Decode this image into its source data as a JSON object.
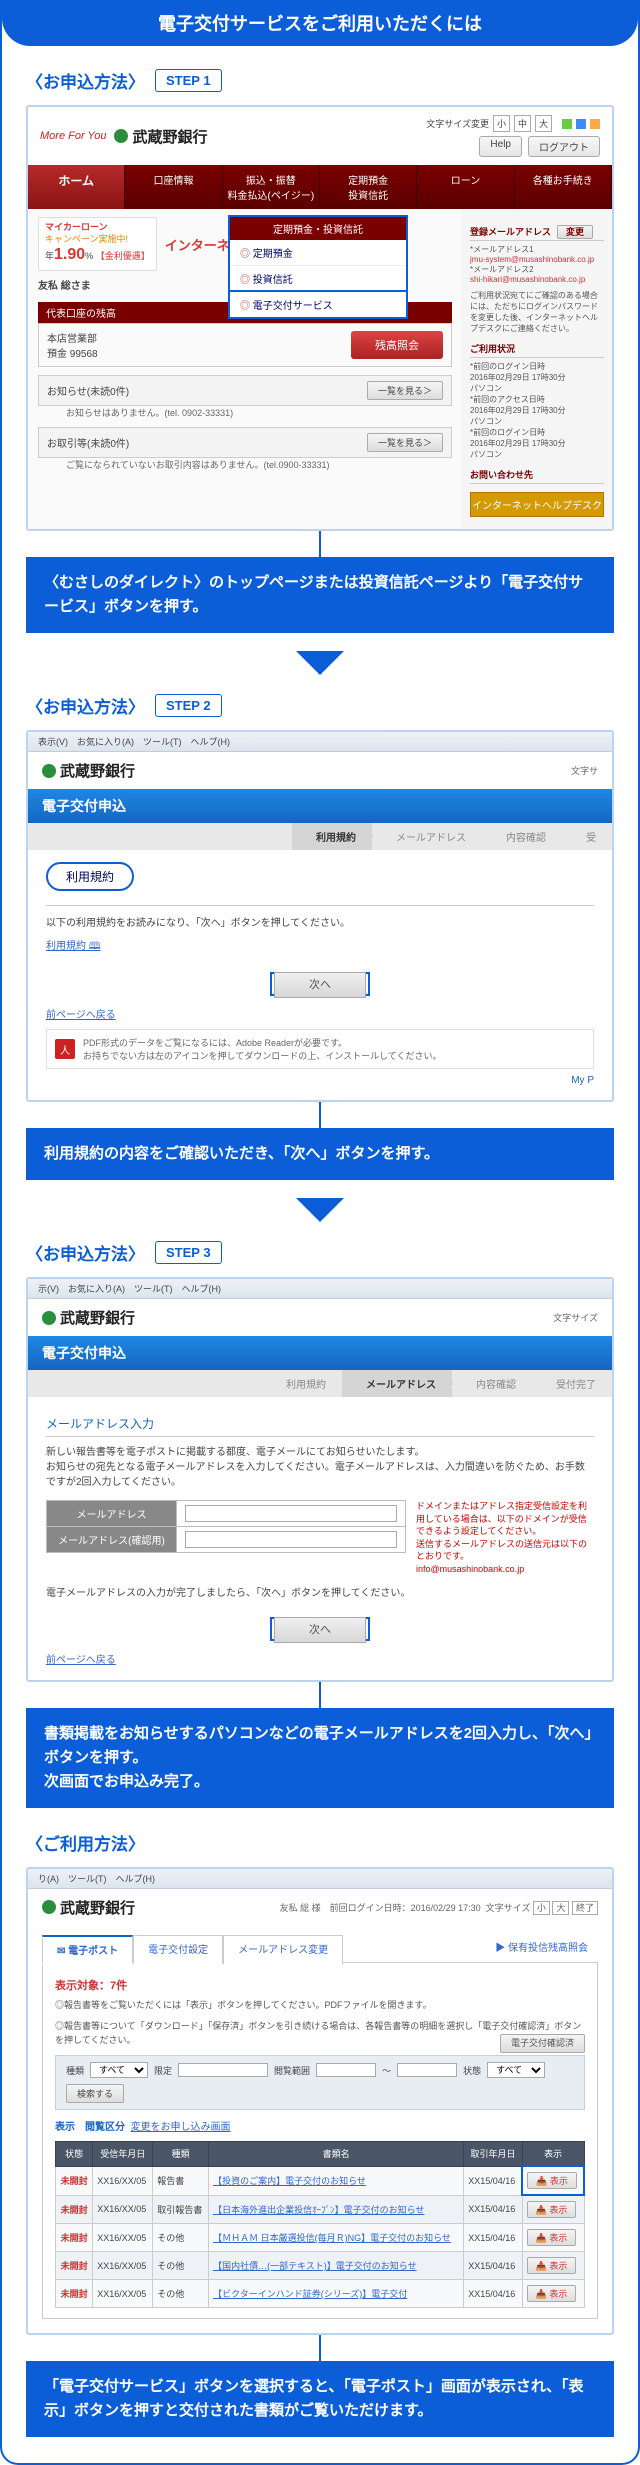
{
  "title": "電子交付サービスをご利用いただくには",
  "section_label": "〈お申込方法〉",
  "usage_label": "〈ご利用方法〉",
  "steps": {
    "s1": "STEP 1",
    "s2": "STEP 2",
    "s3": "STEP 3"
  },
  "captions": {
    "c1": "〈むさしのダイレクト〉のトップページまたは投資信託ページより「電子交付サービス」ボタンを押す。",
    "c2": "利用規約の内容をご確認いただき、「次へ」ボタンを押す。",
    "c3": "書類掲載をお知らせするパソコンなどの電子メールアドレスを2回入力し、「次へ」ボタンを押す。\n次画面でお申込み完了。",
    "c4": "「電子交付サービス」ボタンを選択すると、「電子ポスト」画面が表示され、「表示」ボタンを押すと交付された書類がご覧いただけます。"
  },
  "s1": {
    "mfy": "More For You",
    "bank": "武蔵野銀行",
    "font_label": "文字サイズ変更",
    "fs": [
      "小",
      "中",
      "大"
    ],
    "help": "Help",
    "logout": "ログアウト",
    "nav": [
      "ホーム",
      "口座情報",
      "振込・振替\n料金払込(ペイジー)",
      "定期預金\n投資信託",
      "ローン",
      "各種お手続き"
    ],
    "popup_hd": "定期預金・投資信託",
    "popup_items": [
      "定期預金",
      "投資信託",
      "電子交付サービス"
    ],
    "mycar_t": "マイカーローン",
    "mycar_s": "キャンペーン実施中!",
    "mycar_pre": "年",
    "mycar_rate": "1.90",
    "mycar_pct": "%",
    "mycar_note": "【金利優遇】",
    "internet": "インターネ",
    "greet": "友私 総さま",
    "sec_balance": "代表口座の残高",
    "acct_branch": "本店営業部",
    "acct_type": "預金 99568",
    "inquiry_btn": "残高照会",
    "notice_hd": "お知らせ(未読0件)",
    "notice_txt": "お知らせはありません。(tel. 0902-33331)",
    "deal_hd": "お取引等(未読0件)",
    "deal_txt": "ご覧になられていないお取引内容はありません。(tel.0900-33331)",
    "list_btn": "一覧を見る＞",
    "right": {
      "r1_hd": "登録メールアドレス",
      "r1_chg": "変更",
      "r1_sub": "*メールアドレス1",
      "r1_v1": "jmu-system@musashinobank.co.jp",
      "r1_sub2": "*メールアドレス2",
      "r1_v2": "shi-hikari@musashinobank.co.jp",
      "r2_hd": "ご利用状況宛てにご確認のある場合には、ただちにログインパスワードを変更した後、インターネットヘルプデスクにご連絡ください。",
      "r3_hd": "ご利用状況",
      "r3_a": "*前回のログイン日時",
      "r3_av": "2016年02月29日 17時30分\nパソコン",
      "r3_b": "*前回のアクセス日時",
      "r3_bv": "2016年02月29日 17時30分\nパソコン",
      "r3_c": "*前回のログイン日時",
      "r3_cv": "2016年02月29日 17時30分\nパソコン",
      "r4_hd": "お問い合わせ先",
      "helpdesk": "インターネットヘルプデスク"
    }
  },
  "s2": {
    "ie": "表示(V)　お気に入り(A)　ツール(T)　ヘルプ(H)",
    "bank": "武蔵野銀行",
    "right": "文字サ",
    "band": "電子交付申込",
    "crumbs": [
      "利用規約",
      "メールアドレス",
      "内容確認",
      "受"
    ],
    "oval": "利用規約",
    "txt": "以下の利用規約をお読みになり、「次へ」ボタンを押してください。",
    "link": "利用規約 🕮",
    "next": "次へ",
    "back": "前ページへ戻る",
    "pdf1": "PDF形式のデータをご覧になるには、Adobe Readerが必要です。",
    "pdf2": "お持ちでない方は左のアイコンを押してダウンロードの上、インストールしてください。",
    "myp": "My P"
  },
  "s3": {
    "ie": "示(V)　お気に入り(A)　ツール(T)　ヘルプ(H)",
    "bank": "武蔵野銀行",
    "right": "文字サイズ",
    "band": "電子交付申込",
    "crumbs": [
      "利用規約",
      "メールアドレス",
      "内容確認",
      "受付完了"
    ],
    "sec_hd": "メールアドレス入力",
    "para1": "新しい報告書等を電子ポストに掲載する都度、電子メールにてお知らせいたします。",
    "para2": "お知らせの宛先となる電子メールアドレスを入力してください。電子メールアドレスは、入力間違いを防ぐため、お手数ですが2回入力してください。",
    "fld1": "メールアドレス",
    "fld2": "メールアドレス(確認用)",
    "rnote1": "ドメインまたはアドレス指定受信設定を利用している場合は、以下のドメインが受信できるよう設定してください。",
    "rnote2": "送信するメールアドレスの送信元は以下のとおりです。",
    "rnote3": "info@musashinobank.co.jp",
    "done": "電子メールアドレスの入力が完了しましたら、「次へ」ボタンを押してください。",
    "next": "次へ",
    "back": "前ページへ戻る"
  },
  "s4": {
    "ie": "り(A)　ツール(T)　ヘルプ(H)",
    "bank": "武蔵野銀行",
    "user_info": "友私 総 様　前回ログイン日時：2016/02/29 17:30",
    "font_label": "文字サイズ",
    "fs": [
      "小",
      "大",
      "終了"
    ],
    "tabs": [
      "電子ポスト",
      "電子交付設定",
      "メールアドレス変更"
    ],
    "tab_icon": "✉",
    "right_link": "▶ 保有投信残高照会",
    "count": "表示対象：7件",
    "note1": "◎報告書等をご覧いただくには「表示」ボタンを押してください。PDFファイルを開きます。",
    "note2": "◎報告書等について「ダウンロード」「保存済」ボタンを引き続ける場合は、各報告書等の明細を選択し「電子交付確認済」ボタンを押してください。",
    "confirm_btn": "電子交付確認済",
    "sub_hd": "表示　閲覧区分",
    "sub_link": "変更をお申し込み画面",
    "sb_lbl_kind": "種類",
    "sb_all": "すべて",
    "sb_strict": "限定",
    "sb_lbl_period": "閲覧範囲",
    "sb_lbl_stat": "状態",
    "sb_search": "検索する",
    "th": [
      "状態",
      "受信年月日",
      "種類",
      "書類名",
      "取引年月日",
      "表示"
    ],
    "rows": [
      {
        "st": "未開封",
        "d1": "XX16/XX/05",
        "k": "報告書",
        "doc": "【投資のご案内】電子交付のお知らせ",
        "d2": "XX15/04/16",
        "b": "表示"
      },
      {
        "st": "未開封",
        "d1": "XX16/XX/05",
        "k": "取引報告書",
        "doc": "【日本海外進出企業投信ｵｰﾌﾟﾝ】電子交付のお知らせ",
        "d2": "XX15/04/16",
        "b": "表示"
      },
      {
        "st": "未開封",
        "d1": "XX16/XX/05",
        "k": "その他",
        "doc": "【ＭＨＡＭ 日本厳選投信(毎月Ｒ)NG】電子交付のお知らせ",
        "d2": "XX15/04/16",
        "b": "表示"
      },
      {
        "st": "未開封",
        "d1": "XX16/XX/05",
        "k": "その他",
        "doc": "【国内社債…(一部テキスト)】電子交付のお知らせ",
        "d2": "XX15/04/16",
        "b": "表示"
      },
      {
        "st": "未開封",
        "d1": "XX16/XX/05",
        "k": "その他",
        "doc": "【ビクターインハンド証券(シリーズ)】電子交付",
        "d2": "XX15/04/16",
        "b": "表示"
      }
    ]
  }
}
